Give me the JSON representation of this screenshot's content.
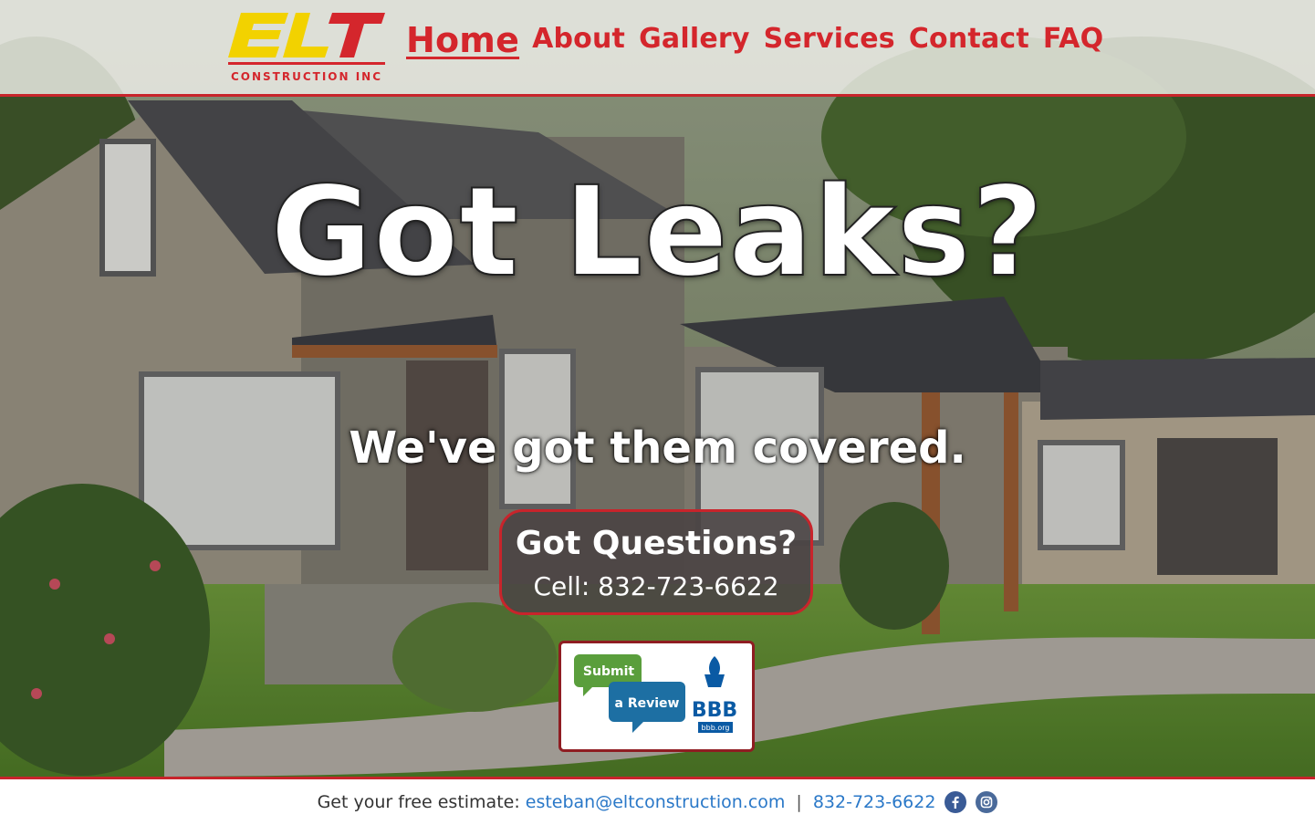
{
  "brand": {
    "logo_text": "ELT",
    "logo_subtext": "CONSTRUCTION INC"
  },
  "nav": [
    {
      "label": "Home",
      "active": true
    },
    {
      "label": "About"
    },
    {
      "label": "Gallery"
    },
    {
      "label": "Services"
    },
    {
      "label": "Contact"
    },
    {
      "label": "FAQ"
    }
  ],
  "hero": {
    "title": "Got Leaks?",
    "subtitle": "We've got them covered."
  },
  "cta": {
    "heading": "Got Questions?",
    "phone_label": "Cell: 832-723-6622"
  },
  "bbb_badge": {
    "line1": "Submit",
    "line2": "a Review",
    "brand": "BBB",
    "site": "bbb.org",
    "icon": "bbb-torch-icon"
  },
  "footer": {
    "label": "Get your free estimate:",
    "email": "esteban@eltconstruction.com",
    "separator": "|",
    "phone": "832-723-6622",
    "social": [
      "facebook-icon",
      "instagram-icon"
    ]
  },
  "colors": {
    "accent": "#d4262c",
    "logo_yellow": "#f2d200",
    "footer_link": "#2a78c8",
    "bbb_blue": "#0a5aa4",
    "bbb_green": "#5a9e3c"
  }
}
